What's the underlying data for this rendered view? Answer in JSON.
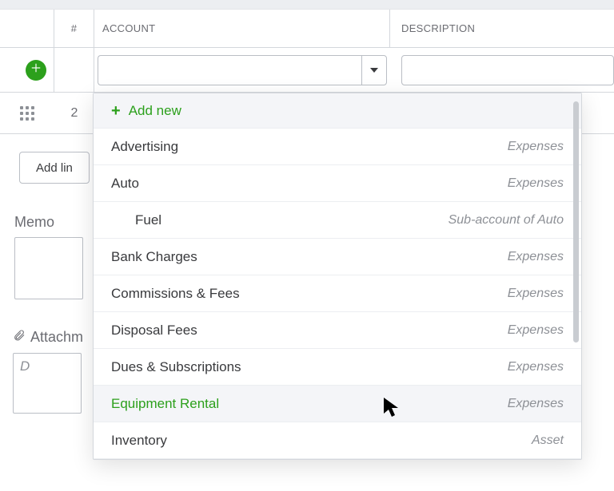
{
  "columns": {
    "num": "#",
    "account": "ACCOUNT",
    "description": "DESCRIPTION"
  },
  "row2": {
    "num": "2"
  },
  "buttons": {
    "add_lines": "Add lin"
  },
  "memo": {
    "label": "Memo"
  },
  "attachments": {
    "label": "Attachm",
    "hint": "D"
  },
  "dropdown": {
    "add_new": "Add new",
    "items": [
      {
        "name": "Advertising",
        "meta": "Expenses"
      },
      {
        "name": "Auto",
        "meta": "Expenses"
      },
      {
        "name": "Fuel",
        "meta": "Sub-account of Auto",
        "indent": true
      },
      {
        "name": "Bank Charges",
        "meta": "Expenses"
      },
      {
        "name": "Commissions & Fees",
        "meta": "Expenses"
      },
      {
        "name": "Disposal Fees",
        "meta": "Expenses"
      },
      {
        "name": "Dues & Subscriptions",
        "meta": "Expenses"
      },
      {
        "name": "Equipment Rental",
        "meta": "Expenses",
        "hover": true
      },
      {
        "name": "Inventory",
        "meta": "Asset"
      }
    ]
  },
  "colors": {
    "accent": "#2ca01c"
  }
}
